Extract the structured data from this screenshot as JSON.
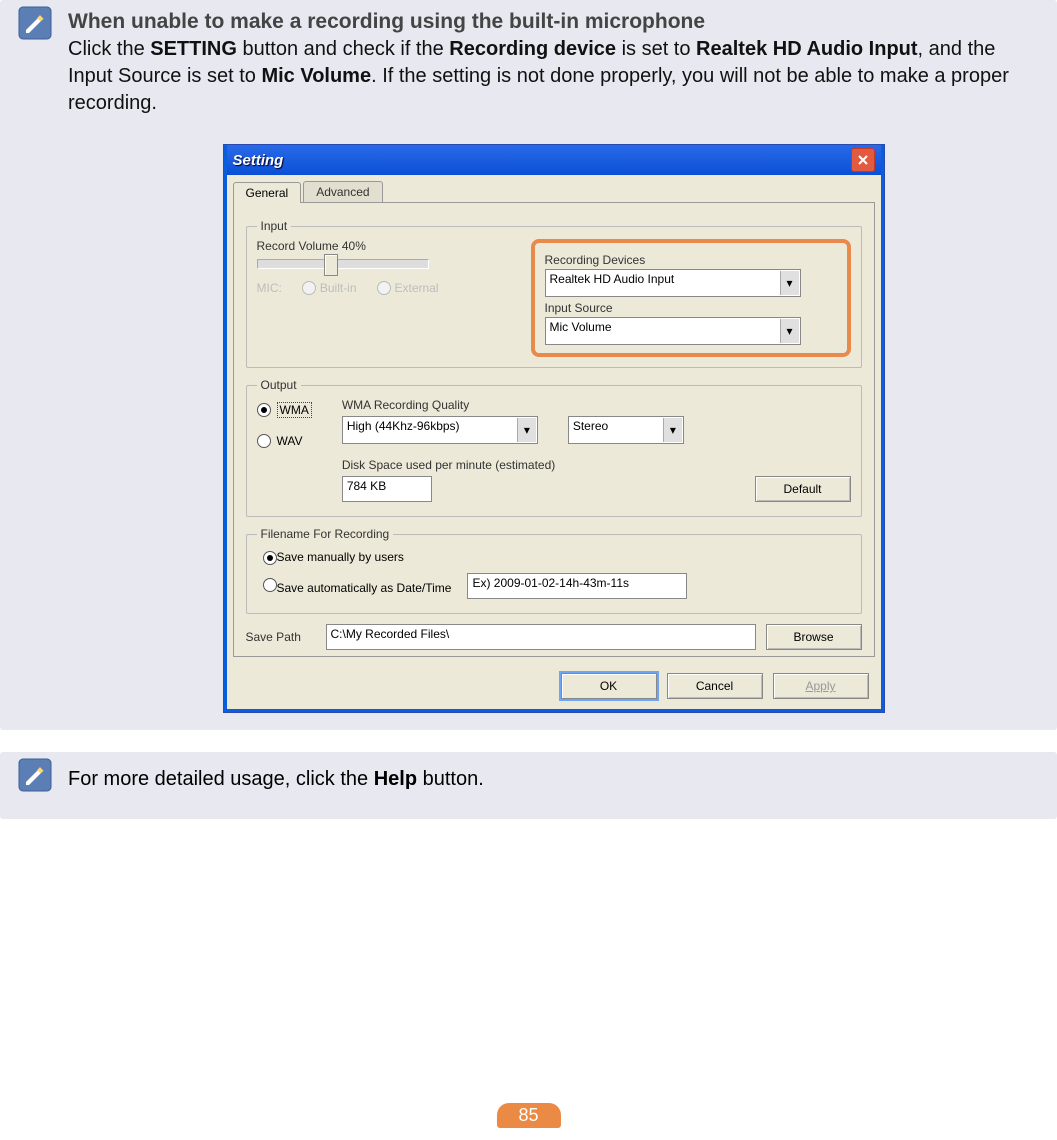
{
  "note1": {
    "title": "When unable to make a recording using the built-in microphone",
    "t1": "Click the ",
    "b1": "SETTING",
    "t2": " button and check if the ",
    "b2": "Recording device",
    "t3": " is set to ",
    "b3": "Realtek HD Audio Input",
    "t4": ", and the Input Source is set to ",
    "b4": "Mic Volume",
    "t5": ". If the setting is not done properly, you will not be able to make a proper recording."
  },
  "dialog": {
    "title": "Setting",
    "tabs": {
      "general": "General",
      "advanced": "Advanced"
    },
    "input": {
      "group": "Input",
      "recordVolume": "Record Volume 40%",
      "micLabel": "MIC:",
      "micBuiltIn": "Built-in",
      "micExternal": "External",
      "recordingDevicesLabel": "Recording Devices",
      "recordingDevicesValue": "Realtek HD Audio Input",
      "inputSourceLabel": "Input Source",
      "inputSourceValue": "Mic Volume"
    },
    "output": {
      "group": "Output",
      "wma": "WMA",
      "wav": "WAV",
      "qualityLabel": "WMA Recording Quality",
      "qualityValue": "High (44Khz-96kbps)",
      "channelValue": "Stereo",
      "diskLabel": "Disk Space used per minute (estimated)",
      "diskValue": "784 KB",
      "defaultBtn": "Default"
    },
    "filename": {
      "group": "Filename For Recording",
      "opt1": "Save manually by users",
      "opt2": "Save automatically as Date/Time",
      "example": "Ex) 2009-01-02-14h-43m-11s"
    },
    "savePathLabel": "Save Path",
    "savePathValue": "C:\\My Recorded Files\\",
    "browseBtn": "Browse",
    "ok": "OK",
    "cancel": "Cancel",
    "apply": "Apply"
  },
  "note2": {
    "t1": "For more detailed usage, click the ",
    "b1": "Help",
    "t2": " button."
  },
  "pageNumber": "85"
}
